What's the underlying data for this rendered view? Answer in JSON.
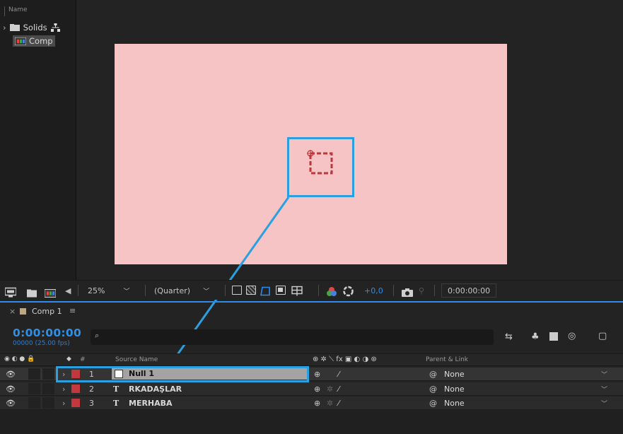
{
  "project": {
    "header": "Name",
    "items": [
      {
        "label": "Solids",
        "icon": "folder-icon"
      },
      {
        "label": "Comp",
        "icon": "composition-icon"
      }
    ]
  },
  "viewer": {
    "zoom": "25%",
    "resolution": "(Quarter)",
    "exposure": "+0,0",
    "timecode": "0:00:00:00",
    "canvas_color": "#f6c4c5"
  },
  "timeline": {
    "tab_label": "Comp 1",
    "current_time": "0:00:00:00",
    "frames": "00000 (25.00 fps)",
    "headers": {
      "number": "#",
      "source_name": "Source Name",
      "parent_link": "Parent & Link"
    },
    "layers": [
      {
        "number": "1",
        "name": "Null 1",
        "type": "null",
        "parent": "None",
        "selected": true
      },
      {
        "number": "2",
        "name": "RKADAŞLAR",
        "type": "text",
        "type_glyph": "T",
        "parent": "None",
        "selected": false
      },
      {
        "number": "3",
        "name": "MERHABA",
        "type": "text",
        "type_glyph": "T",
        "parent": "None",
        "selected": false
      }
    ]
  },
  "colors": {
    "accent_blue": "#2d8ceb",
    "label_red": "#c2383c",
    "callout": "#2aa0e0"
  }
}
